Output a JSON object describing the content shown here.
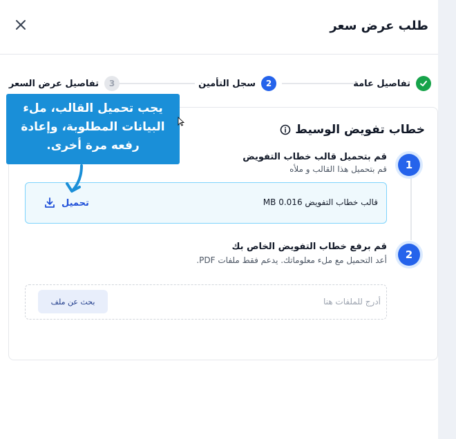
{
  "dialog": {
    "title": "طلب عرض سعر",
    "close_icon": "close-icon"
  },
  "steps": [
    {
      "label": "تفاصيل عامة",
      "state": "done"
    },
    {
      "label": "سجل التأمين",
      "number": "2",
      "state": "active"
    },
    {
      "label": "تفاصيل عرض السعر",
      "number": "3",
      "state": "todo"
    }
  ],
  "card": {
    "title": "خطاب تفويض الوسيط",
    "step1": {
      "number": "1",
      "title": "قم بتحميل قالب خطاب التفويض",
      "subtitle": "قم بتحميل هذا القالب و ملأه"
    },
    "template": {
      "name": "قالب خطاب التفويض 0.016 MB",
      "download_label": "تحميل"
    },
    "step2": {
      "number": "2",
      "title": "قم برفع خطاب التفويض الخاص بك",
      "subtitle": "أعد التحميل مع ملء معلوماتك. يدعم فقط ملفات PDF."
    },
    "dropzone": {
      "placeholder": "أدرج للملفات هنا",
      "browse_label": "بحث عن ملف"
    }
  },
  "tooltip": {
    "line1": "يجب تحميل القالب، ملء",
    "line2": "البيانات المطلوبة، وإعادة",
    "line3": "رفعه مرة أخرى."
  },
  "colors": {
    "primary": "#2563eb",
    "success": "#16a34a",
    "tooltip": "#1a8fd8"
  }
}
